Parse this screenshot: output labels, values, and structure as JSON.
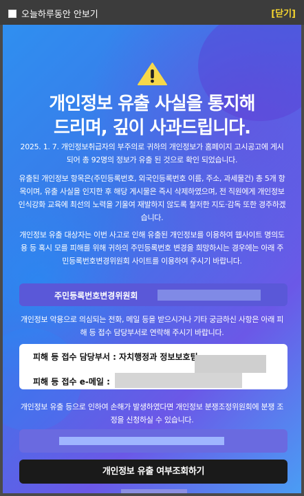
{
  "topbar": {
    "hide_today_label": "오늘하루동안 안보기",
    "close_label": "[닫기]"
  },
  "notice": {
    "icon": "warning-icon",
    "title": "개인정보 유출 사실을 통지해\n드리며, 깊이 사과드립니다.",
    "paragraph1": "2025. 1. 7. 개인정보취급자의 부주의로 귀하의 개인정보가 홈페이지 고시공고에 게시되어 총 92명의 정보가 유출 된 것으로 확인 되었습니다.",
    "paragraph2": "유출된 개인정보 항목은(주민등록번호, 외국인등록번호 이름, 주소, 과세물건) 총 5개 항목이며, 유출 사실을 인지한 후 해당 게시물은 즉시 삭제하였으며, 전 직원에게 개인정보 인식강화 교육에 최선의 노력을 기울여 재발하지 않도록 철저한 지도·감독 또한 경주하겠습니다.",
    "paragraph3": "개인정보 유출 대상자는 이번 사고로 인해 유출된 개인정보를 이용하여 웹사이트 명의도용 등 혹시 모를 피해를 위해 귀하의 주민등록번호 변경을 희망하시는 경우에는 아래 주민등록번호변경위원회 사이트를 이용하여 주시기 바랍니다.",
    "site_label": "주민등록번호변경위원회",
    "paragraph4": "개인정보 악용으로 의심되는 전화, 메일 등을 받으시거나 기타 궁금하신 사항은 아래 피해 등 접수 담당부서로 연락해 주시기 바랍니다.",
    "dept_label": "피해 등 접수 담당부서 : 자치행정과 정보보호팀",
    "email_label": "피해 등 접수 e-메일 :",
    "paragraph5": "개인정보 유출 등으로 인하여 손해가 발생하였다면 개인정보 분쟁조정위원회에 분쟁 조정을 신청하실 수 있습니다.",
    "check_button_label": "개인정보 유출 여부조회하기"
  },
  "colors": {
    "top_bar": "#3c3c3c",
    "accent": "#f5d52f",
    "button": "#1a1a1a"
  }
}
